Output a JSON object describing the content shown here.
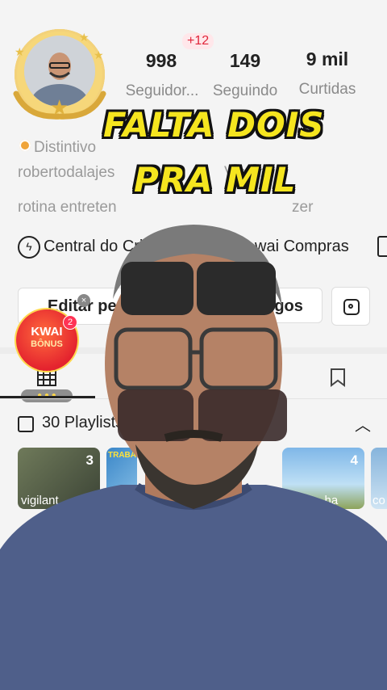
{
  "profile": {
    "stats": [
      {
        "value": "998",
        "label": "Seguidor..."
      },
      {
        "value": "149",
        "label": "Seguindo"
      },
      {
        "value": "9 mil",
        "label": "Curtidas"
      }
    ],
    "followers_delta": "+12",
    "badge_text": "Distintivo",
    "username": "robertodalajes",
    "bio_line": "rotina entreten",
    "bio_tail": "zer",
    "bio_mid": "Visa   m"
  },
  "overlay_caption": {
    "line1": "FALTA DOIS",
    "line2": "PRA MIL"
  },
  "links": {
    "creator_center": "Central do Cri",
    "kwai_shop": "wai Compras"
  },
  "buttons": {
    "edit_profile": "Editar pe",
    "friends": "migos"
  },
  "kwai_bonus": {
    "title": "KWAI",
    "subtitle": "BÔNUS",
    "count": "2",
    "close": "×"
  },
  "playlists": {
    "header": "30 Playlists",
    "items": [
      {
        "count": "3",
        "caption": "vigilant"
      },
      {
        "count": "",
        "caption": "TRABA"
      },
      {
        "count": "4",
        "caption": "...ha"
      },
      {
        "count": "",
        "caption": "co"
      }
    ]
  },
  "colors": {
    "caption_yellow": "#f5e51f",
    "accent_red": "#e0253a",
    "shirt_blue": "#4f5f8a"
  }
}
